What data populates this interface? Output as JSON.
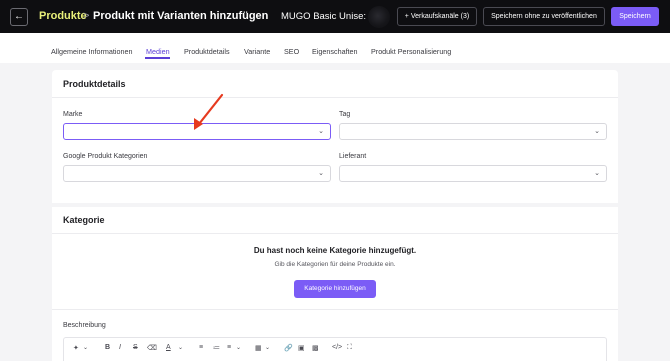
{
  "header": {
    "back_icon": "arrow-left-icon",
    "breadcrumb_root": "Produkte",
    "breadcrumb_sep": ">",
    "page_title": "Produkt mit Varianten hinzufügen",
    "product_name": "MUGO Basic Unise:",
    "channels_button": "+ Verkaufskanäle (3)",
    "save_unpublished_button": "Speichern ohne zu veröffentlichen",
    "save_button": "Speichern"
  },
  "tabs": [
    {
      "label": "Allgemeine Informationen"
    },
    {
      "label": "Medien"
    },
    {
      "label": "Produktdetails"
    },
    {
      "label": "Variante"
    },
    {
      "label": "SEO"
    },
    {
      "label": "Eigenschaften"
    },
    {
      "label": "Produkt Personalisierung"
    }
  ],
  "active_tab": "Medien",
  "details": {
    "title": "Produktdetails",
    "brand_label": "Marke",
    "brand_value": "",
    "tag_label": "Tag",
    "tag_value": "",
    "google_label": "Google Produkt Kategorien",
    "google_value": "",
    "supplier_label": "Lieferant",
    "supplier_value": ""
  },
  "category": {
    "title": "Kategorie",
    "empty_title": "Du hast noch keine Kategorie hinzugefügt.",
    "empty_subtitle": "Gib die Kategorien für deine Produkte ein.",
    "add_button": "Kategorie hinzufügen"
  },
  "description": {
    "label": "Beschreibung",
    "toolbar_icons": [
      "magic-icon",
      "chevron-down-icon",
      "bold-icon",
      "italic-icon",
      "strikethrough-icon",
      "eraser-icon",
      "text-color-icon",
      "chevron-down-icon",
      "bullet-list-icon",
      "numbered-list-icon",
      "align-icon",
      "chevron-down-icon",
      "table-icon",
      "chevron-down-icon",
      "link-icon",
      "image-icon",
      "video-icon",
      "code-icon",
      "fullscreen-icon"
    ]
  },
  "colors": {
    "accent": "#7b5cf6",
    "breadcrumb": "#e9f07a",
    "topbar": "#0e0e11",
    "annotation_arrow": "#e63a1f"
  }
}
